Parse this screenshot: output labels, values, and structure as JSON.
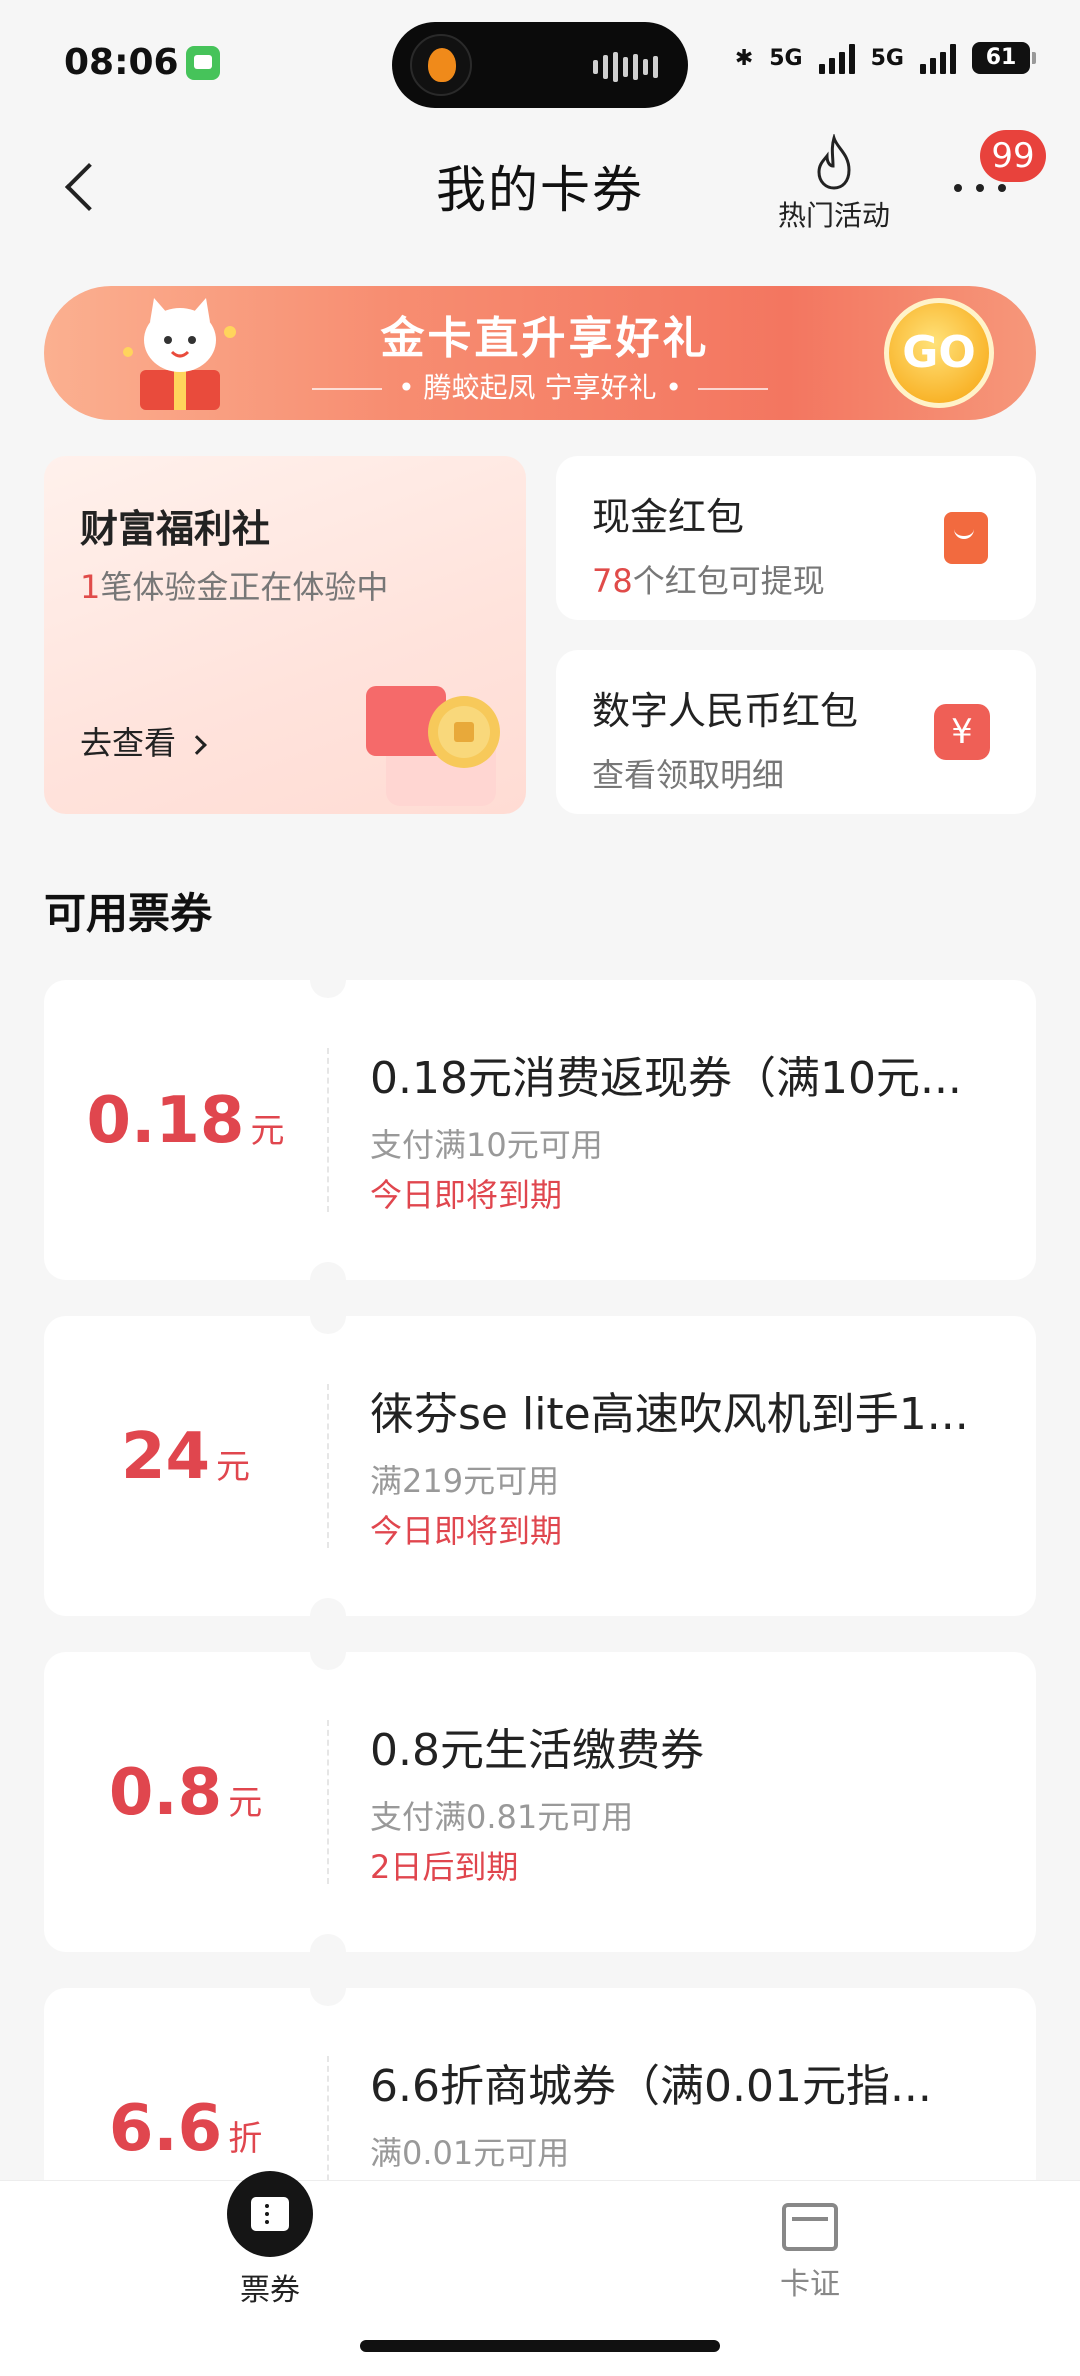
{
  "status_bar": {
    "time": "08:06",
    "network_1": "5G",
    "network_2": "5G",
    "battery": "61"
  },
  "header": {
    "title": "我的卡券",
    "hot_label": "热门活动",
    "badge": "99"
  },
  "banner": {
    "title": "金卡直升享好礼",
    "subtitle": "• 腾蛟起凤 宁享好礼 •",
    "go_label": "GO"
  },
  "wealth": {
    "title": "财富福利社",
    "sub_count": "1",
    "sub_text": "笔体验金正在体验中",
    "link": "去查看"
  },
  "cash": {
    "title": "现金红包",
    "count": "78",
    "sub_text": "个红包可提现"
  },
  "dcep": {
    "title": "数字人民币红包",
    "sub": "查看领取明细",
    "icon_glyph": "¥"
  },
  "section_title": "可用票券",
  "coupons": [
    {
      "amount": "0.18",
      "unit": "元",
      "name": "0.18元消费返现券（满10元...",
      "condition": "支付满10元可用",
      "expiry": "今日即将到期"
    },
    {
      "amount": "24",
      "unit": "元",
      "name": "徕芬se lite高速吹风机到手1...",
      "condition": "满219元可用",
      "expiry": "今日即将到期"
    },
    {
      "amount": "0.8",
      "unit": "元",
      "name": "0.8元生活缴费券",
      "condition": "支付满0.81元可用",
      "expiry": "2日后到期"
    },
    {
      "amount": "6.6",
      "unit": "折",
      "name": "6.6折商城券（满0.01元指...",
      "condition": "满0.01元可用",
      "expiry": ""
    }
  ],
  "nav": {
    "tickets": "票券",
    "cards": "卡证"
  },
  "colors": {
    "accent_red": "#e0464e",
    "badge_red": "#e8423c",
    "banner": "#f37660"
  },
  "icons": [
    "back-icon",
    "flame-icon",
    "more-icon",
    "go-icon",
    "red-packet-icon",
    "digital-yuan-icon",
    "ticket-icon",
    "card-icon"
  ]
}
